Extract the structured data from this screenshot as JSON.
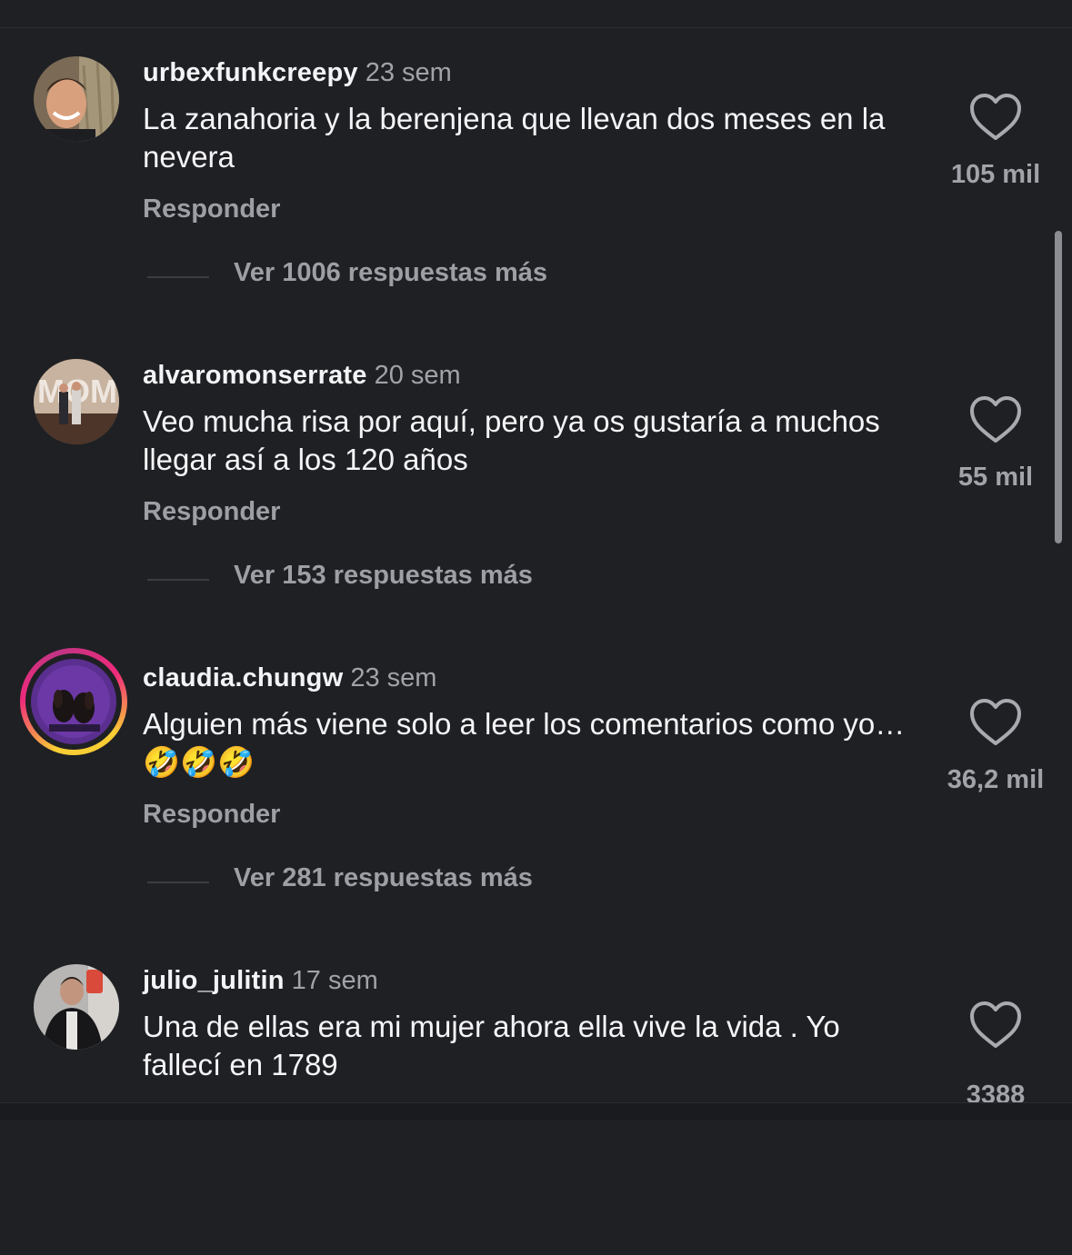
{
  "comments": [
    {
      "username": "urbexfunkcreepy",
      "time": "23 sem",
      "text": "La zanahoria y la berenjena que llevan dos meses en la nevera",
      "reply_label": "Responder",
      "likes": "105 mil",
      "more_replies": "Ver 1006 respuestas más",
      "heart_icon": "heart-outline-icon"
    },
    {
      "username": "alvaromonserrate",
      "time": "20 sem",
      "text": "Veo mucha risa por aquí, pero ya os gustaría a muchos llegar así a los 120 años",
      "reply_label": "Responder",
      "likes": "55 mil",
      "more_replies": "Ver 153 respuestas más",
      "heart_icon": "heart-outline-icon"
    },
    {
      "username": "claudia.chungw",
      "time": "23 sem",
      "text": "Alguien más viene solo a leer los comentarios como yo… 🤣🤣🤣",
      "reply_label": "Responder",
      "likes": "36,2 mil",
      "more_replies": "Ver 281 respuestas más",
      "heart_icon": "heart-outline-icon",
      "story_ring": true
    },
    {
      "username": "julio_julitin",
      "time": "17 sem",
      "text": "Una de ellas era mi mujer ahora ella vive la vida . Yo fallecí en 1789",
      "likes": "3388",
      "heart_icon": "heart-outline-icon"
    }
  ],
  "colors": {
    "background": "#1f2024",
    "primary_text": "#f3f4f6",
    "secondary_text": "#9d9fa5",
    "story_ring": "#ee2a7b"
  }
}
